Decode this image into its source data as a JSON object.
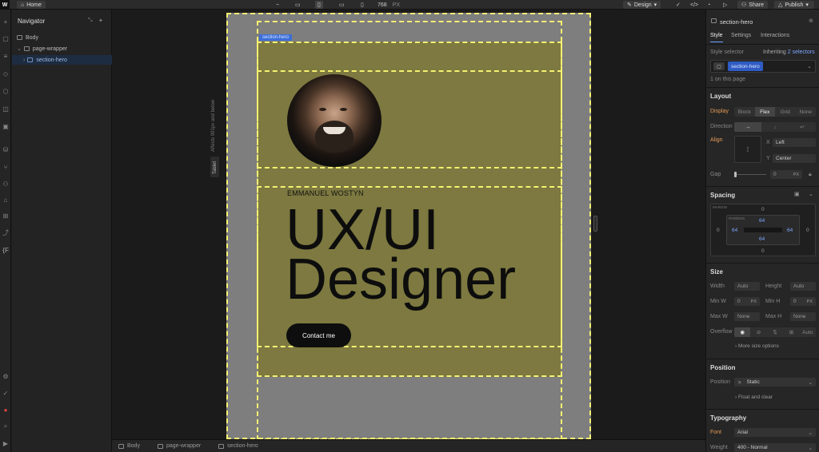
{
  "topbar": {
    "logo": "W",
    "home_label": "Home",
    "width_value": "768",
    "width_unit": "PX",
    "mode_label": "Design",
    "share_label": "Share",
    "publish_label": "Publish"
  },
  "navigator": {
    "title": "Navigator",
    "items": [
      {
        "label": "Body"
      },
      {
        "label": "page-wrapper"
      },
      {
        "label": "section-hero"
      }
    ]
  },
  "canvas": {
    "selected_tag": "section-hero",
    "breakpoint_label": "Tablet",
    "breakpoint_note": "Affects 991px and below",
    "hero": {
      "name": "EMMANUEL WOSTYN",
      "title_line1": "UX/UI",
      "title_line2": "Designer",
      "cta_label": "Contact me"
    }
  },
  "breadcrumb": [
    "Body",
    "page-wrapper",
    "section-hero"
  ],
  "panel": {
    "element_name": "section-hero",
    "tabs": [
      "Style",
      "Settings",
      "Interactions"
    ],
    "style_selector_label": "Style selector",
    "inheriting_label": "Inheriting",
    "inheriting_count": "2 selectors",
    "selector_chip": "section-hero",
    "on_page": "1 on this page",
    "layout": {
      "title": "Layout",
      "display_label": "Display",
      "display_options": [
        "Block",
        "Flex",
        "Grid",
        "None"
      ],
      "display_selected": "Flex",
      "direction_label": "Direction",
      "align_label": "Align",
      "x_label": "X",
      "x_value": "Left",
      "y_label": "Y",
      "y_value": "Center",
      "gap_label": "Gap",
      "gap_value": "0",
      "gap_unit": "PX"
    },
    "spacing": {
      "title": "Spacing",
      "margin_label": "MARGIN",
      "padding_label": "PADDING",
      "margin_top": "0",
      "margin_right": "0",
      "margin_bottom": "0",
      "margin_left": "0",
      "padding_top": "64",
      "padding_right": "64",
      "padding_bottom": "64",
      "padding_left": "64"
    },
    "size": {
      "title": "Size",
      "width_label": "Width",
      "width_value": "Auto",
      "height_label": "Height",
      "height_value": "Auto",
      "minw_label": "Min W",
      "minw_value": "0",
      "minh_label": "Min H",
      "minh_value": "0",
      "maxw_label": "Max W",
      "maxw_value": "None",
      "maxh_label": "Max H",
      "maxh_value": "None",
      "unit": "PX",
      "overflow_label": "Overflow",
      "overflow_auto": "Auto",
      "more_label": "More size options"
    },
    "position": {
      "title": "Position",
      "position_label": "Position",
      "position_value": "Static",
      "float_label": "Float and clear"
    },
    "typography": {
      "title": "Typography",
      "font_label": "Font",
      "font_value": "Arial",
      "weight_label": "Weight",
      "weight_value": "400 - Normal"
    }
  },
  "colors": {
    "hero_bg": "#7d7940",
    "dash": "#f5f272",
    "selection_blue": "#3d6fd8",
    "accent_orange": "#e39b57"
  }
}
